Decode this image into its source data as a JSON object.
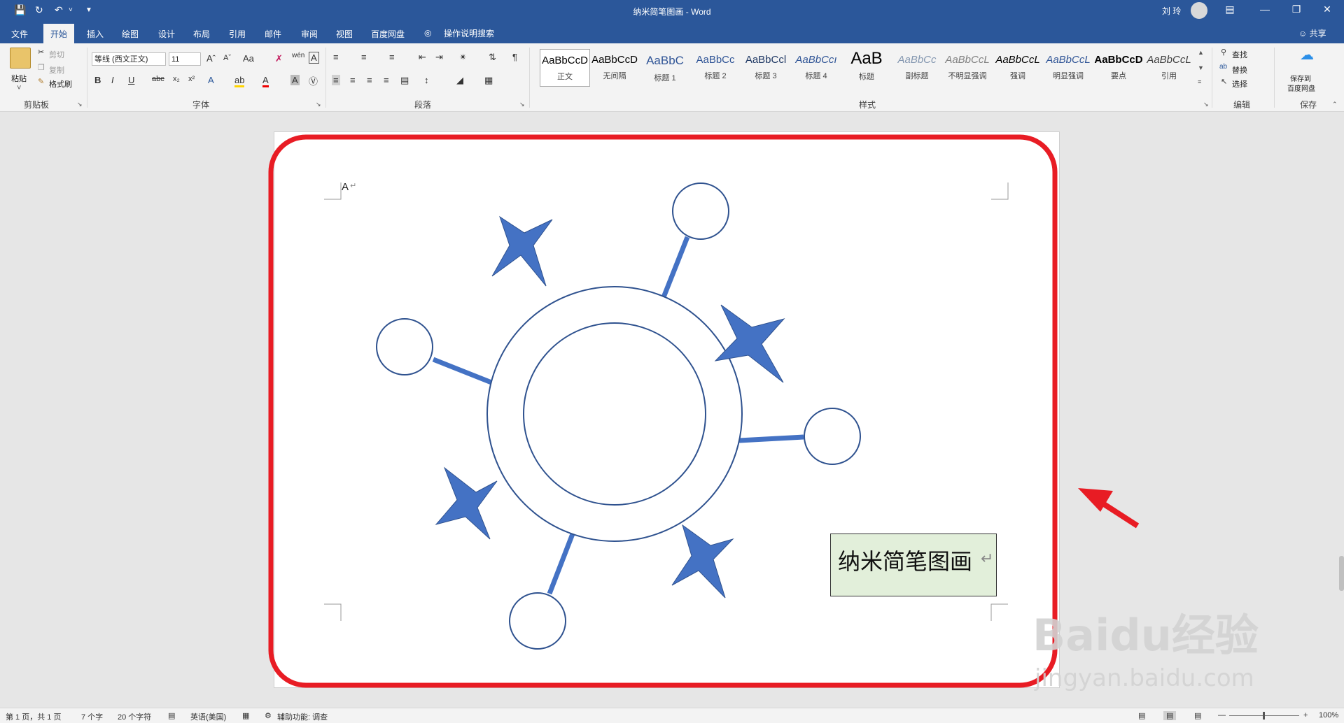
{
  "titlebar": {
    "doc_title": "纳米简笔图画",
    "app_name": "Word",
    "user_name": "刘 玲",
    "separator": " - "
  },
  "tabs": [
    "文件",
    "开始",
    "插入",
    "绘图",
    "设计",
    "布局",
    "引用",
    "邮件",
    "审阅",
    "视图",
    "百度网盘"
  ],
  "active_tab": "开始",
  "tell_me": "操作说明搜索",
  "share": "共享",
  "ribbon": {
    "clipboard": {
      "paste": "粘贴",
      "cut": "剪切",
      "copy": "复制",
      "format_painter": "格式刷",
      "label": "剪贴板"
    },
    "font": {
      "name": "等线 (西文正文)",
      "size": "11",
      "label": "字体"
    },
    "paragraph": {
      "label": "段落"
    },
    "styles": {
      "label": "样式",
      "items": [
        {
          "preview": "AaBbCcD",
          "name": "正文"
        },
        {
          "preview": "AaBbCcD",
          "name": "无间隔"
        },
        {
          "preview": "AaBbC",
          "name": "标题 1"
        },
        {
          "preview": "AaBbCc",
          "name": "标题 2"
        },
        {
          "preview": "AaBbCcl",
          "name": "标题 3"
        },
        {
          "preview": "AaBbCcı",
          "name": "标题 4"
        },
        {
          "preview": "AaB",
          "name": "标题"
        },
        {
          "preview": "AaBbCc",
          "name": "副标题"
        },
        {
          "preview": "AaBbCcL",
          "name": "不明显强调"
        },
        {
          "preview": "AaBbCcL",
          "name": "强调"
        },
        {
          "preview": "AaBbCcL",
          "name": "明显强调"
        },
        {
          "preview": "AaBbCcD",
          "name": "要点"
        },
        {
          "preview": "AaBbCcL",
          "name": "引用"
        }
      ]
    },
    "editing": {
      "find": "查找",
      "replace": "替换",
      "select": "选择",
      "label": "编辑"
    },
    "save": {
      "line1": "保存到",
      "line2": "百度网盘",
      "label": "保存"
    }
  },
  "document": {
    "textbox": "纳米简笔图画",
    "cursor_char": "A",
    "shape_fill": "#4472c4",
    "shape_stroke": "#2f528f",
    "textbox_fill": "#e2efda",
    "annotation_color": "#e81c24"
  },
  "statusbar": {
    "page": "第 1 页，共 1 页",
    "words": "7 个字",
    "chars": "20 个字符",
    "language": "英语(美国)",
    "accessibility": "辅助功能: 调查",
    "zoom": "100%"
  },
  "watermark": {
    "brand": "Baidu经验",
    "url": "jingyan.baidu.com"
  }
}
